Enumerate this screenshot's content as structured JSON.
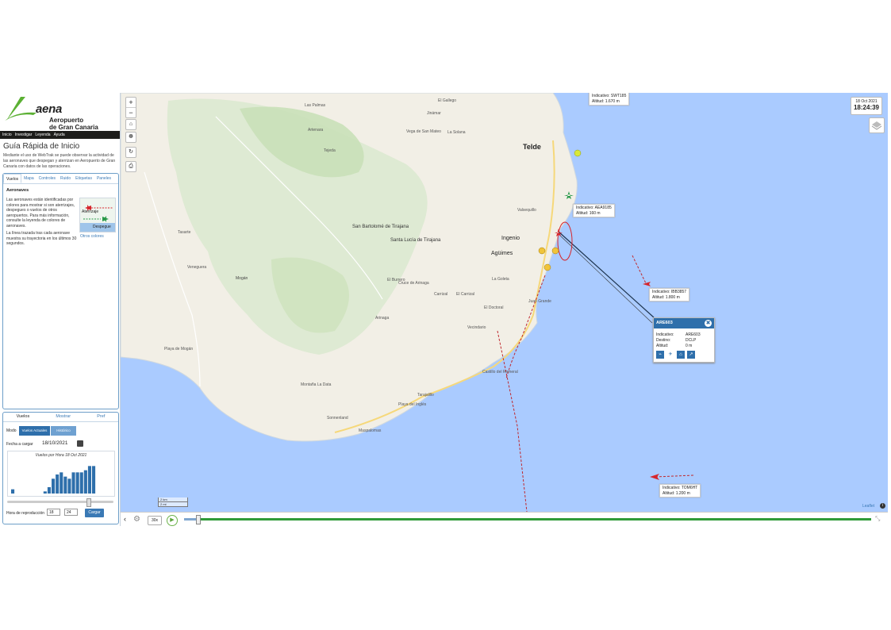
{
  "brand": {
    "name": "aena",
    "line1": "Aeropuerto",
    "line2": "de Gran Canaria"
  },
  "nav": [
    "Inicio",
    "Investigar",
    "Leyenda",
    "Ayuda"
  ],
  "guide": {
    "title": "Guía Rápida de Inicio",
    "text": "Mediante el uso de WebTrak se puede observar la actividad de las aeronaves que despegan y aterrizan en Aeropuerto de Gran Canaria con datos de las operaciones."
  },
  "tabs": [
    "Vuelos",
    "Mapa",
    "Controles",
    "Ruido",
    "Etiquetas",
    "Paneles"
  ],
  "aeronaves": {
    "title": "Aeronaves",
    "text": "Las aeronaves están identificadas por colores para mostrar si son aterrizajes, despegues o vuelos de otros aeropuertos. Para más información, consulte la leyenda de colores de aeronaves.",
    "text2": "La línea trazada tras cada aeronave muestra su trayectoria en los últimos 30 segundos.",
    "legend": {
      "arrival": "Aterrizaje",
      "departure": "Despegue"
    },
    "otros": "Otros colores"
  },
  "controls": {
    "tabs": [
      "Vuelos",
      "Mostrar",
      "Pref"
    ],
    "modo_label": "Modo",
    "modo_options": [
      "Vuelos Actuales",
      "Histórico"
    ],
    "fecha_label": "Fecha a cargar",
    "fecha_value": "18/10/2021",
    "histo_title": "Vuelos por Hora 18 Oct 2021",
    "histo_values": [
      2,
      0,
      0,
      0,
      0,
      0,
      0,
      0,
      1,
      3,
      7,
      9,
      10,
      8,
      7,
      10,
      10,
      10,
      11,
      13,
      13,
      0,
      0,
      0
    ],
    "slider_fraction": 0.77,
    "hora_label": "Hora de reproducción",
    "hora_h": "18",
    "hora_m": "24",
    "cargar": "Cargar"
  },
  "map": {
    "zoom_in": "+",
    "zoom_out": "−",
    "clock_date": "18 Oct 2021",
    "clock_time": "18:24:39",
    "attribution": "Leaflet",
    "scale": [
      "2 km",
      "2 mi"
    ],
    "places": [
      {
        "name": "Telde"
      },
      {
        "name": "Ingenio"
      },
      {
        "name": "Agüimes"
      },
      {
        "name": "Santa Lucía de Tirajana"
      },
      {
        "name": "San Bartolomé de Tirajana"
      },
      {
        "name": "Mogán"
      },
      {
        "name": "Arinaga"
      },
      {
        "name": "Tejeda"
      },
      {
        "name": "Vega de San Mateo"
      },
      {
        "name": "Valsequillo"
      },
      {
        "name": "Juan Grande"
      },
      {
        "name": "Tarajalillo"
      },
      {
        "name": "El Burrero"
      },
      {
        "name": "La Goleta"
      },
      {
        "name": "Carrizal"
      },
      {
        "name": "Artenara"
      },
      {
        "name": "Playa de Mogán"
      },
      {
        "name": "Veneguera"
      },
      {
        "name": "Tasarte"
      },
      {
        "name": "El Doctoral"
      },
      {
        "name": "Cruce de Arinaga"
      },
      {
        "name": "El Carrizal"
      },
      {
        "name": "Vecindario"
      },
      {
        "name": "Castillo del Romeral"
      },
      {
        "name": "Jinámar"
      },
      {
        "name": "El Gallego"
      },
      {
        "name": "La Solana"
      },
      {
        "name": "Montaña La Data"
      },
      {
        "name": "Sonnenland"
      },
      {
        "name": "Playa del Inglés"
      },
      {
        "name": "Maspalomas"
      },
      {
        "name": "Las Palmas"
      }
    ],
    "flights": [
      {
        "callsign_label": "Indicativo:",
        "callsign": "SWT185",
        "alt_label": "Altitud:",
        "alt": "1.670 m"
      },
      {
        "callsign_label": "Indicativo:",
        "callsign": "AEA9185",
        "alt_label": "Altitud:",
        "alt": "160 m"
      },
      {
        "callsign_label": "Indicativo:",
        "callsign": "IBB3857",
        "alt_label": "Altitud:",
        "alt": "1.800 m"
      },
      {
        "callsign_label": "Indicativo:",
        "callsign": "TOM6HT",
        "alt_label": "Altitud:",
        "alt": "1.200 m"
      }
    ],
    "popup": {
      "title": "ARE603",
      "rows": [
        {
          "label": "Indicativo:",
          "value": "ARE603"
        },
        {
          "label": "Destino:",
          "value": "DCLP"
        },
        {
          "label": "Altitud:",
          "value": "0 m"
        }
      ]
    },
    "colors": {
      "water": "#aacbff",
      "land": "#f2efe6",
      "relief": "#d6e8c8",
      "arrival": "#d6262c",
      "departure": "#2a9a4a",
      "popup": "#2e6fab"
    }
  },
  "playback": {
    "speed": "30x",
    "progress": 1.0
  }
}
